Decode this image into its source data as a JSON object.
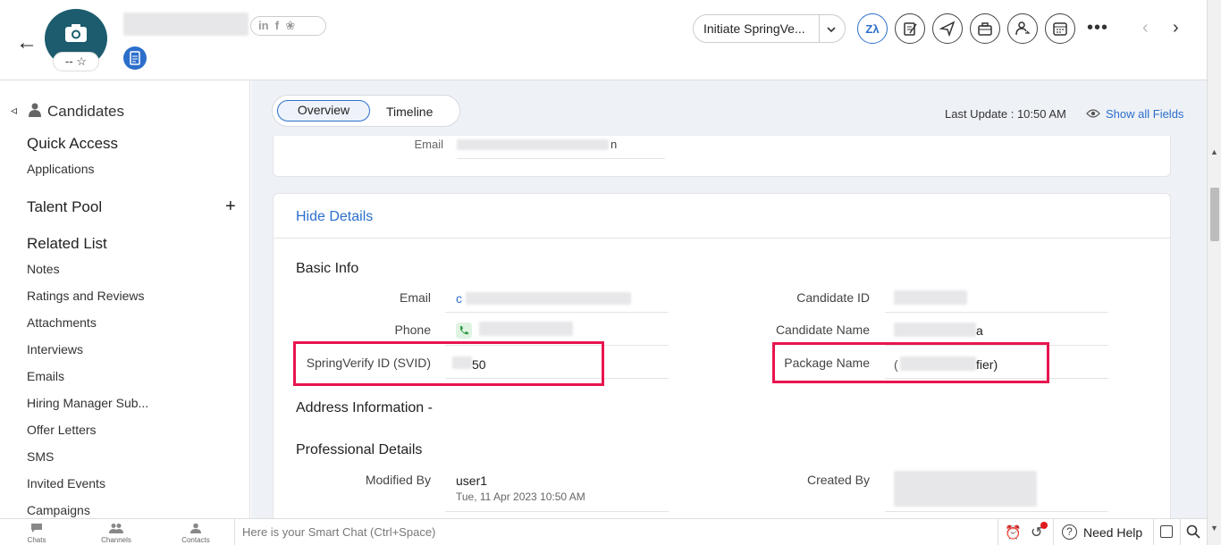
{
  "header": {
    "avatar_rating": "--",
    "initiate_button": "Initiate SpringVe...",
    "toolbar_icons": [
      "zia-icon",
      "notes-icon",
      "send-icon",
      "briefcase-icon",
      "assign-icon",
      "schedule-icon",
      "more-icon"
    ]
  },
  "sidebar": {
    "module": "Candidates",
    "quick_access": "Quick Access",
    "applications": "Applications",
    "talent_pool": "Talent Pool",
    "talent_pool_add": "+",
    "related_list": "Related List",
    "items": [
      "Notes",
      "Ratings and Reviews",
      "Attachments",
      "Interviews",
      "Emails",
      "Hiring Manager Sub...",
      "Offer Letters",
      "SMS",
      "Invited Events",
      "Campaigns"
    ]
  },
  "tabs": {
    "overview": "Overview",
    "timeline": "Timeline"
  },
  "last_update": "Last Update : 10:50 AM",
  "show_all_fields": "Show all Fields",
  "top_card": {
    "email_label": "Email",
    "email_suffix": "n"
  },
  "details": {
    "hide_details": "Hide Details",
    "basic_info": "Basic Info",
    "email_label": "Email",
    "email_value_prefix": "c",
    "phone_label": "Phone",
    "svid_label": "SpringVerify ID (SVID)",
    "svid_suffix": "50",
    "candidate_id_label": "Candidate ID",
    "candidate_name_label": "Candidate Name",
    "candidate_name_suffix": "a",
    "package_name_label": "Package Name",
    "package_name_prefix": "(",
    "package_name_suffix": "fier)",
    "address_information": "Address Information -",
    "professional_details": "Professional Details",
    "modified_by_label": "Modified By",
    "modified_by_value": "user1",
    "modified_by_date": "Tue, 11 Apr 2023 10:50 AM",
    "created_by_label": "Created By"
  },
  "footer": {
    "chats": "Chats",
    "channels": "Channels",
    "contacts": "Contacts",
    "smart_chat_placeholder": "Here is your Smart Chat (Ctrl+Space)",
    "need_help": "Need Help"
  },
  "colors": {
    "accent": "#2c6fcb",
    "highlight": "#e8154f",
    "avatar": "#1c5c6e"
  }
}
